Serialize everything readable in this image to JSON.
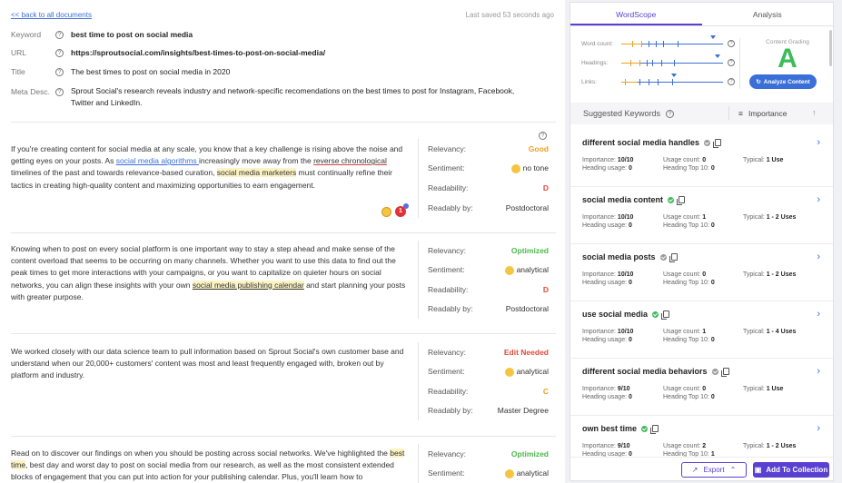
{
  "editor": {
    "back_link": "<< back to all documents",
    "last_saved": "Last saved 53 seconds ago",
    "meta": [
      {
        "label": "Keyword",
        "value": "best time to post on social media"
      },
      {
        "label": "URL",
        "value": "https://sproutsocial.com/insights/best-times-to-post-on-social-media/"
      },
      {
        "label": "Title",
        "value": "The best times to post on social media in 2020"
      },
      {
        "label": "Meta Desc.",
        "value": "Sprout Social's research reveals industry and network-specific recomendations on the best times to post for Instagram, Facebook, Twitter and LinkedIn."
      }
    ],
    "stat_labels": {
      "relevancy": "Relevancy:",
      "sentiment": "Sentiment:",
      "readability": "Readability:",
      "readably_by": "Readably by:"
    },
    "paragraphs": [
      {
        "t1": "If you're creating content for social media at any scale, you know that a key challenge is rising above the noise and getting eyes on your posts. As ",
        "link": "social media algorithms ",
        "t2": "increasingly move away from the ",
        "und": "reverse chronological",
        "t3": " timelines of the past and towards relevance-based curation, ",
        "hl": "social media marketers",
        "t4": " must continually refine their tactics in creating high-quality content and maximizing opportunities to earn engagement.",
        "relevancy": "Good",
        "sentiment": "no tone",
        "readability": "D",
        "readably_by": "Postdoctoral",
        "badge_count": "1"
      },
      {
        "t1": "Knowing when to post on every social platform is one important way to stay a step ahead and make sense of the content overload that seems to be occurring on many channels. Whether you want to use this data to find out the peak times to get more interactions with your campaigns, or you want to capitalize on quieter hours on social networks, you can align these insights with your own ",
        "hl": "social media publishing calendar",
        "t2": " and start planning your posts with greater purpose.",
        "relevancy": "Optimized",
        "sentiment": "analytical",
        "readability": "D",
        "readably_by": "Postdoctoral"
      },
      {
        "t1": "We worked closely with our data science team to pull information based on Sprout Social's own customer base and understand when our 20,000+ customers' content was most and least frequently engaged with, broken out by platform and industry.",
        "relevancy": "Edit Needed",
        "sentiment": "analytical",
        "readability": "C",
        "readably_by": "Master Degree"
      },
      {
        "t1": "Read on to discover our findings on when you should be posting across social networks. We've highlighted the ",
        "hl1": "best time",
        "t2": ", best day and worst day to post on social media from our research, as well as the most consistent extended blocks of engagement that you can put into action for your publishing calendar. Plus, you'll learn how to",
        "relevancy": "Optimized",
        "sentiment": "analytical"
      }
    ]
  },
  "panel": {
    "tabs": [
      "WordScope",
      "Analysis"
    ],
    "bars": [
      {
        "label": "Word count:",
        "marker_pct": 0.9
      },
      {
        "label": "Headings:",
        "marker_pct": 0.95
      },
      {
        "label": "Links:",
        "marker_pct": 0.52
      }
    ],
    "grade_title": "Content Grading",
    "grade": "A",
    "analyze_button": "Analyze Content",
    "suggested_title": "Suggested Keywords",
    "sort_label": "Importance",
    "stat_labels": {
      "importance": "Importance:",
      "heading_usage": "Heading usage:",
      "usage_count": "Usage count:",
      "heading_top10": "Heading Top 10:",
      "typical": "Typical:"
    },
    "keywords": [
      {
        "name": "different social media handles",
        "status": "gray",
        "importance": "10/10",
        "heading_usage": "0",
        "usage_count": "0",
        "heading_top10": "0",
        "typical": "1 Use"
      },
      {
        "name": "social media content",
        "status": "green",
        "importance": "10/10",
        "heading_usage": "0",
        "usage_count": "1",
        "heading_top10": "0",
        "typical": "1 - 2 Uses"
      },
      {
        "name": "social media posts",
        "status": "gray",
        "importance": "10/10",
        "heading_usage": "0",
        "usage_count": "0",
        "heading_top10": "0",
        "typical": "1 - 2 Uses"
      },
      {
        "name": "use social media",
        "status": "green",
        "importance": "10/10",
        "heading_usage": "0",
        "usage_count": "1",
        "heading_top10": "0",
        "typical": "1 - 4 Uses"
      },
      {
        "name": "different social media behaviors",
        "status": "gray",
        "importance": "9/10",
        "heading_usage": "0",
        "usage_count": "0",
        "heading_top10": "0",
        "typical": "1 Use"
      },
      {
        "name": "own best time",
        "status": "green",
        "importance": "9/10",
        "heading_usage": "0",
        "usage_count": "2",
        "heading_top10": "1",
        "typical": "1 - 2 Uses"
      }
    ],
    "export_label": "Export",
    "add_collection_label": "Add To Collection"
  },
  "colors": {
    "accent": "#5a3fd0",
    "link": "#3b6fd8",
    "grade": "#3dbb5a"
  }
}
